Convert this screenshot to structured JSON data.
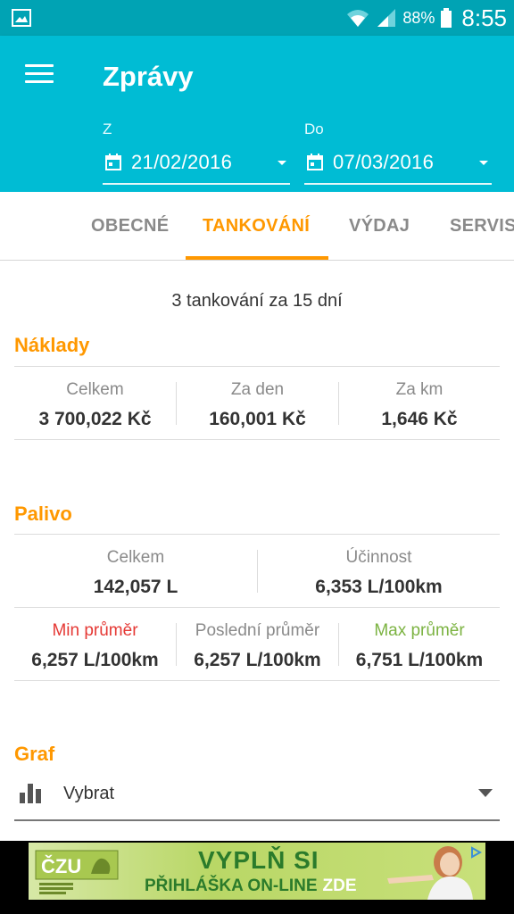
{
  "status_bar": {
    "battery_percent": "88%",
    "time": "8:55"
  },
  "app_bar": {
    "title": "Zprávy",
    "from": {
      "label": "Z",
      "value": "21/02/2016"
    },
    "to": {
      "label": "Do",
      "value": "07/03/2016"
    }
  },
  "tabs": [
    {
      "label": "OBECNÉ"
    },
    {
      "label": "TANKOVÁNÍ"
    },
    {
      "label": "VÝDAJ"
    },
    {
      "label": "SERVIS"
    }
  ],
  "active_tab": "TANKOVÁNÍ",
  "summary": "3 tankování za 15 dní",
  "costs": {
    "title": "Náklady",
    "items": [
      {
        "label": "Celkem",
        "value": "3 700,022 Kč"
      },
      {
        "label": "Za den",
        "value": "160,001 Kč"
      },
      {
        "label": "Za km",
        "value": "1,646 Kč"
      }
    ]
  },
  "fuel": {
    "title": "Palivo",
    "row1": [
      {
        "label": "Celkem",
        "value": "142,057 L"
      },
      {
        "label": "Účinnost",
        "value": "6,353 L/100km"
      }
    ],
    "row2": [
      {
        "label": "Min průměr",
        "value": "6,257 L/100km"
      },
      {
        "label": "Poslední průměr",
        "value": "6,257 L/100km"
      },
      {
        "label": "Max průměr",
        "value": "6,751 L/100km"
      }
    ]
  },
  "graph": {
    "title": "Graf",
    "selected": "Vybrat"
  },
  "ad": {
    "line1": "VYPLŇ SI",
    "line2": "PŘIHLÁŠKA ON-LINE",
    "line2_highlight": "ZDE",
    "logo_text": "ČZU"
  },
  "colors": {
    "primary": "#00bcd4",
    "status": "#00a3b4",
    "accent": "#ff9800",
    "min": "#e53935",
    "max": "#7cb342"
  }
}
